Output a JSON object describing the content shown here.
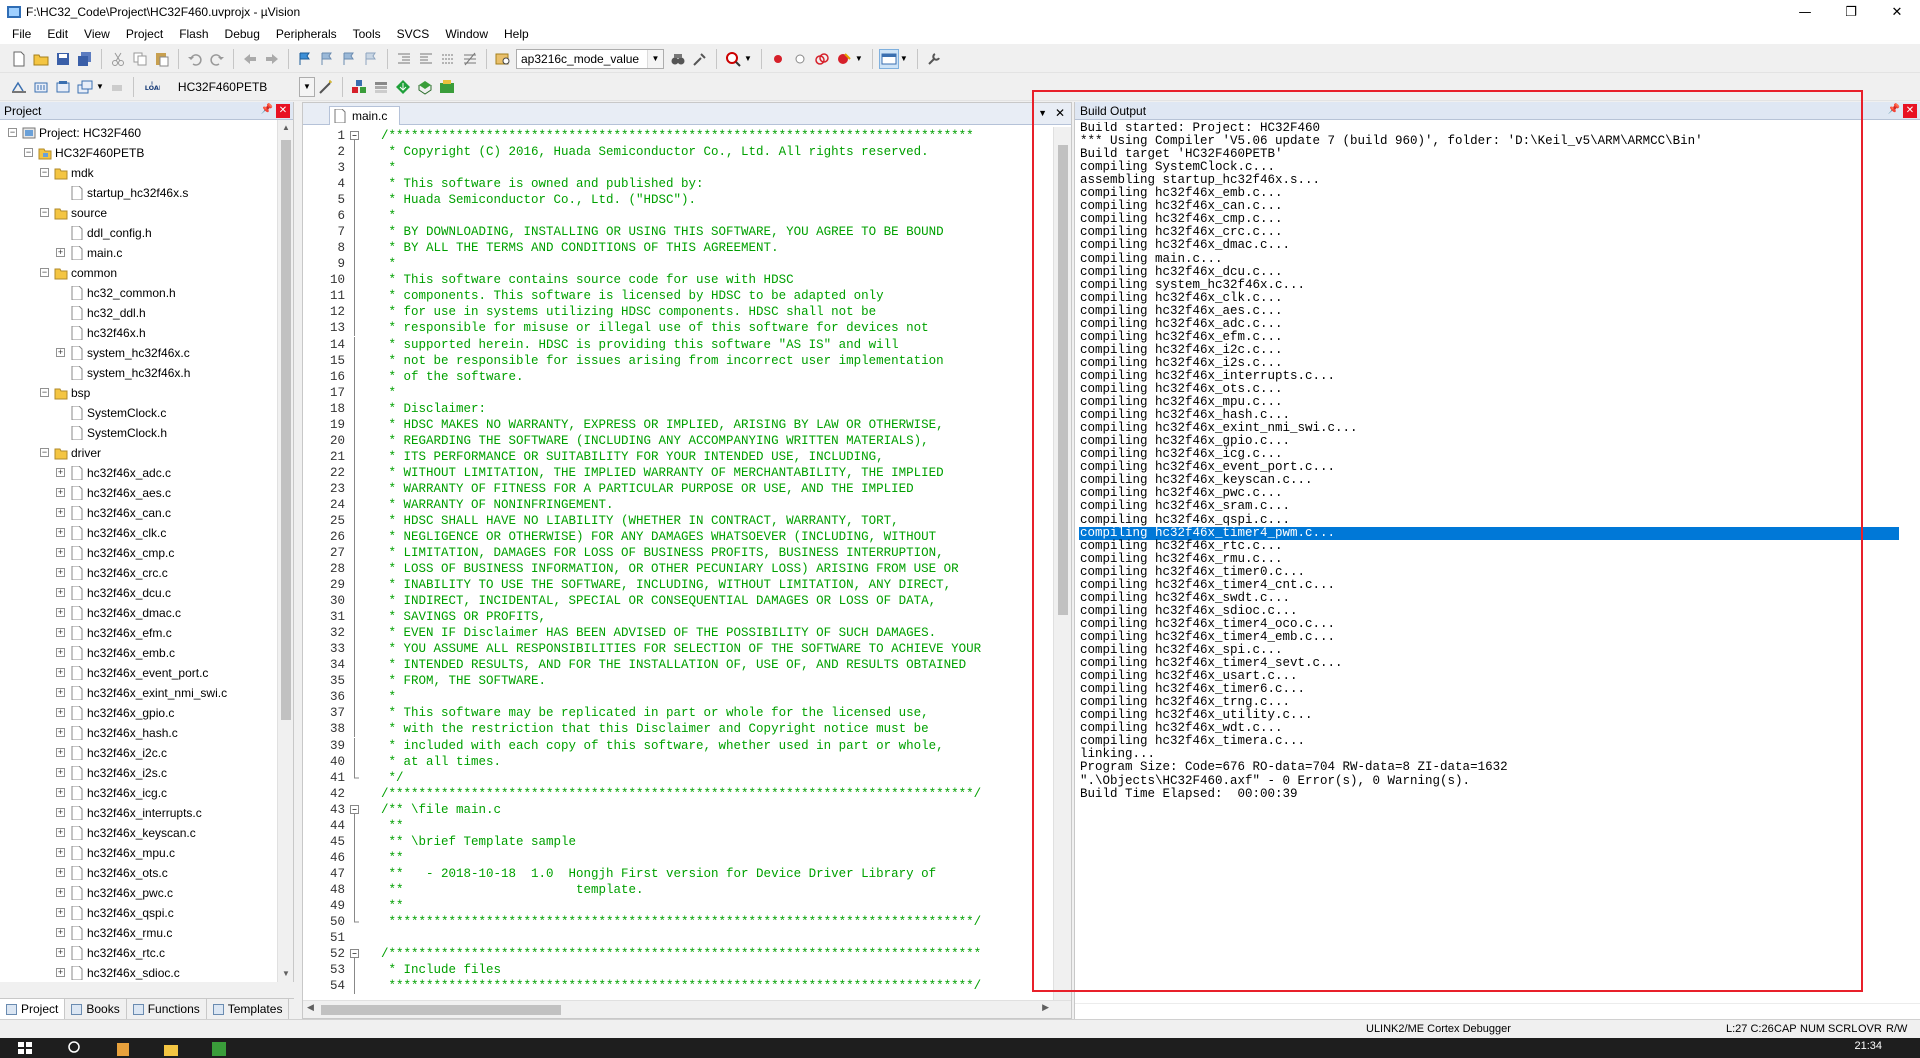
{
  "window": {
    "title": "F:\\HC32_Code\\Project\\HC32F460.uvprojx - µVision",
    "minimize": "—",
    "maximize": "❐",
    "close": "✕"
  },
  "menu": [
    "File",
    "Edit",
    "View",
    "Project",
    "Flash",
    "Debug",
    "Peripherals",
    "Tools",
    "SVCS",
    "Window",
    "Help"
  ],
  "toolbar1": {
    "function_combo": "ap3216c_mode_value"
  },
  "toolbar2": {
    "load_label": "LOAD",
    "target_combo": "HC32F460PETB"
  },
  "project_panel": {
    "title": "Project",
    "tree": [
      {
        "label": "Project: HC32F460",
        "level": 0,
        "type": "project",
        "expander": "−"
      },
      {
        "label": "HC32F460PETB",
        "level": 1,
        "type": "target",
        "expander": "−"
      },
      {
        "label": "mdk",
        "level": 2,
        "type": "folder",
        "expander": "−"
      },
      {
        "label": "startup_hc32f46x.s",
        "level": 3,
        "type": "file",
        "expander": ""
      },
      {
        "label": "source",
        "level": 2,
        "type": "folder",
        "expander": "−"
      },
      {
        "label": "ddl_config.h",
        "level": 3,
        "type": "file",
        "expander": ""
      },
      {
        "label": "main.c",
        "level": 3,
        "type": "file",
        "expander": "+"
      },
      {
        "label": "common",
        "level": 2,
        "type": "folder",
        "expander": "−"
      },
      {
        "label": "hc32_common.h",
        "level": 3,
        "type": "file",
        "expander": ""
      },
      {
        "label": "hc32_ddl.h",
        "level": 3,
        "type": "file",
        "expander": ""
      },
      {
        "label": "hc32f46x.h",
        "level": 3,
        "type": "file",
        "expander": ""
      },
      {
        "label": "system_hc32f46x.c",
        "level": 3,
        "type": "file",
        "expander": "+"
      },
      {
        "label": "system_hc32f46x.h",
        "level": 3,
        "type": "file",
        "expander": ""
      },
      {
        "label": "bsp",
        "level": 2,
        "type": "folder",
        "expander": "−"
      },
      {
        "label": "SystemClock.c",
        "level": 3,
        "type": "file",
        "expander": ""
      },
      {
        "label": "SystemClock.h",
        "level": 3,
        "type": "file",
        "expander": ""
      },
      {
        "label": "driver",
        "level": 2,
        "type": "folder",
        "expander": "−"
      },
      {
        "label": "hc32f46x_adc.c",
        "level": 3,
        "type": "file",
        "expander": "+"
      },
      {
        "label": "hc32f46x_aes.c",
        "level": 3,
        "type": "file",
        "expander": "+"
      },
      {
        "label": "hc32f46x_can.c",
        "level": 3,
        "type": "file",
        "expander": "+"
      },
      {
        "label": "hc32f46x_clk.c",
        "level": 3,
        "type": "file",
        "expander": "+"
      },
      {
        "label": "hc32f46x_cmp.c",
        "level": 3,
        "type": "file",
        "expander": "+"
      },
      {
        "label": "hc32f46x_crc.c",
        "level": 3,
        "type": "file",
        "expander": "+"
      },
      {
        "label": "hc32f46x_dcu.c",
        "level": 3,
        "type": "file",
        "expander": "+"
      },
      {
        "label": "hc32f46x_dmac.c",
        "level": 3,
        "type": "file",
        "expander": "+"
      },
      {
        "label": "hc32f46x_efm.c",
        "level": 3,
        "type": "file",
        "expander": "+"
      },
      {
        "label": "hc32f46x_emb.c",
        "level": 3,
        "type": "file",
        "expander": "+"
      },
      {
        "label": "hc32f46x_event_port.c",
        "level": 3,
        "type": "file",
        "expander": "+"
      },
      {
        "label": "hc32f46x_exint_nmi_swi.c",
        "level": 3,
        "type": "file",
        "expander": "+"
      },
      {
        "label": "hc32f46x_gpio.c",
        "level": 3,
        "type": "file",
        "expander": "+"
      },
      {
        "label": "hc32f46x_hash.c",
        "level": 3,
        "type": "file",
        "expander": "+"
      },
      {
        "label": "hc32f46x_i2c.c",
        "level": 3,
        "type": "file",
        "expander": "+"
      },
      {
        "label": "hc32f46x_i2s.c",
        "level": 3,
        "type": "file",
        "expander": "+"
      },
      {
        "label": "hc32f46x_icg.c",
        "level": 3,
        "type": "file",
        "expander": "+"
      },
      {
        "label": "hc32f46x_interrupts.c",
        "level": 3,
        "type": "file",
        "expander": "+"
      },
      {
        "label": "hc32f46x_keyscan.c",
        "level": 3,
        "type": "file",
        "expander": "+"
      },
      {
        "label": "hc32f46x_mpu.c",
        "level": 3,
        "type": "file",
        "expander": "+"
      },
      {
        "label": "hc32f46x_ots.c",
        "level": 3,
        "type": "file",
        "expander": "+"
      },
      {
        "label": "hc32f46x_pwc.c",
        "level": 3,
        "type": "file",
        "expander": "+"
      },
      {
        "label": "hc32f46x_qspi.c",
        "level": 3,
        "type": "file",
        "expander": "+"
      },
      {
        "label": "hc32f46x_rmu.c",
        "level": 3,
        "type": "file",
        "expander": "+"
      },
      {
        "label": "hc32f46x_rtc.c",
        "level": 3,
        "type": "file",
        "expander": "+"
      },
      {
        "label": "hc32f46x_sdioc.c",
        "level": 3,
        "type": "file",
        "expander": "+"
      }
    ],
    "tabs": [
      {
        "label": "Project",
        "active": true
      },
      {
        "label": "Books",
        "active": false
      },
      {
        "label": "Functions",
        "active": false
      },
      {
        "label": "Templates",
        "active": false
      }
    ]
  },
  "editor": {
    "tab": "main.c",
    "lines": [
      {
        "n": "1",
        "fold": "top",
        "text": "/******************************************************************************"
      },
      {
        "n": "2",
        "fold": "bar",
        "text": " * Copyright (C) 2016, Huada Semiconductor Co., Ltd. All rights reserved."
      },
      {
        "n": "3",
        "fold": "bar",
        "text": " *"
      },
      {
        "n": "4",
        "fold": "bar",
        "text": " * This software is owned and published by:"
      },
      {
        "n": "5",
        "fold": "bar",
        "text": " * Huada Semiconductor Co., Ltd. (\"HDSC\")."
      },
      {
        "n": "6",
        "fold": "bar",
        "text": " *"
      },
      {
        "n": "7",
        "fold": "bar",
        "text": " * BY DOWNLOADING, INSTALLING OR USING THIS SOFTWARE, YOU AGREE TO BE BOUND"
      },
      {
        "n": "8",
        "fold": "bar",
        "text": " * BY ALL THE TERMS AND CONDITIONS OF THIS AGREEMENT."
      },
      {
        "n": "9",
        "fold": "bar",
        "text": " *"
      },
      {
        "n": "10",
        "fold": "bar",
        "text": " * This software contains source code for use with HDSC"
      },
      {
        "n": "11",
        "fold": "bar",
        "text": " * components. This software is licensed by HDSC to be adapted only"
      },
      {
        "n": "12",
        "fold": "bar",
        "text": " * for use in systems utilizing HDSC components. HDSC shall not be"
      },
      {
        "n": "13",
        "fold": "bar",
        "text": " * responsible for misuse or illegal use of this software for devices not"
      },
      {
        "n": "14",
        "fold": "bar",
        "text": " * supported herein. HDSC is providing this software \"AS IS\" and will"
      },
      {
        "n": "15",
        "fold": "bar",
        "text": " * not be responsible for issues arising from incorrect user implementation"
      },
      {
        "n": "16",
        "fold": "bar",
        "text": " * of the software."
      },
      {
        "n": "17",
        "fold": "bar",
        "text": " *"
      },
      {
        "n": "18",
        "fold": "bar",
        "text": " * Disclaimer:"
      },
      {
        "n": "19",
        "fold": "bar",
        "text": " * HDSC MAKES NO WARRANTY, EXPRESS OR IMPLIED, ARISING BY LAW OR OTHERWISE,"
      },
      {
        "n": "20",
        "fold": "bar",
        "text": " * REGARDING THE SOFTWARE (INCLUDING ANY ACCOMPANYING WRITTEN MATERIALS),"
      },
      {
        "n": "21",
        "fold": "bar",
        "text": " * ITS PERFORMANCE OR SUITABILITY FOR YOUR INTENDED USE, INCLUDING,"
      },
      {
        "n": "22",
        "fold": "bar",
        "text": " * WITHOUT LIMITATION, THE IMPLIED WARRANTY OF MERCHANTABILITY, THE IMPLIED"
      },
      {
        "n": "23",
        "fold": "bar",
        "text": " * WARRANTY OF FITNESS FOR A PARTICULAR PURPOSE OR USE, AND THE IMPLIED"
      },
      {
        "n": "24",
        "fold": "bar",
        "text": " * WARRANTY OF NONINFRINGEMENT."
      },
      {
        "n": "25",
        "fold": "bar",
        "text": " * HDSC SHALL HAVE NO LIABILITY (WHETHER IN CONTRACT, WARRANTY, TORT,"
      },
      {
        "n": "26",
        "fold": "bar",
        "text": " * NEGLIGENCE OR OTHERWISE) FOR ANY DAMAGES WHATSOEVER (INCLUDING, WITHOUT"
      },
      {
        "n": "27",
        "fold": "bar",
        "text": " * LIMITATION, DAMAGES FOR LOSS OF BUSINESS PROFITS, BUSINESS INTERRUPTION,"
      },
      {
        "n": "28",
        "fold": "bar",
        "text": " * LOSS OF BUSINESS INFORMATION, OR OTHER PECUNIARY LOSS) ARISING FROM USE OR"
      },
      {
        "n": "29",
        "fold": "bar",
        "text": " * INABILITY TO USE THE SOFTWARE, INCLUDING, WITHOUT LIMITATION, ANY DIRECT,"
      },
      {
        "n": "30",
        "fold": "bar",
        "text": " * INDIRECT, INCIDENTAL, SPECIAL OR CONSEQUENTIAL DAMAGES OR LOSS OF DATA,"
      },
      {
        "n": "31",
        "fold": "bar",
        "text": " * SAVINGS OR PROFITS,"
      },
      {
        "n": "32",
        "fold": "bar",
        "text": " * EVEN IF Disclaimer HAS BEEN ADVISED OF THE POSSIBILITY OF SUCH DAMAGES."
      },
      {
        "n": "33",
        "fold": "bar",
        "text": " * YOU ASSUME ALL RESPONSIBILITIES FOR SELECTION OF THE SOFTWARE TO ACHIEVE YOUR"
      },
      {
        "n": "34",
        "fold": "bar",
        "text": " * INTENDED RESULTS, AND FOR THE INSTALLATION OF, USE OF, AND RESULTS OBTAINED"
      },
      {
        "n": "35",
        "fold": "bar",
        "text": " * FROM, THE SOFTWARE."
      },
      {
        "n": "36",
        "fold": "bar",
        "text": " *"
      },
      {
        "n": "37",
        "fold": "bar",
        "text": " * This software may be replicated in part or whole for the licensed use,"
      },
      {
        "n": "38",
        "fold": "bar",
        "text": " * with the restriction that this Disclaimer and Copyright notice must be"
      },
      {
        "n": "39",
        "fold": "bar",
        "text": " * included with each copy of this software, whether used in part or whole,"
      },
      {
        "n": "40",
        "fold": "bar",
        "text": " * at all times."
      },
      {
        "n": "41",
        "fold": "end",
        "text": " */"
      },
      {
        "n": "42",
        "fold": "",
        "text": "/******************************************************************************/"
      },
      {
        "n": "43",
        "fold": "top",
        "text": "/** \\file main.c"
      },
      {
        "n": "44",
        "fold": "bar",
        "text": " **"
      },
      {
        "n": "45",
        "fold": "bar",
        "text": " ** \\brief Template sample"
      },
      {
        "n": "46",
        "fold": "bar",
        "text": " **"
      },
      {
        "n": "47",
        "fold": "bar",
        "text": " **   - 2018-10-18  1.0  Hongjh First version for Device Driver Library of"
      },
      {
        "n": "48",
        "fold": "bar",
        "text": " **                       template."
      },
      {
        "n": "49",
        "fold": "bar",
        "text": " **"
      },
      {
        "n": "50",
        "fold": "end",
        "text": " ******************************************************************************/"
      },
      {
        "n": "51",
        "fold": "",
        "text": ""
      },
      {
        "n": "52",
        "fold": "top",
        "text": "/*******************************************************************************"
      },
      {
        "n": "53",
        "fold": "bar",
        "text": " * Include files"
      },
      {
        "n": "54",
        "fold": "bar",
        "text": " ******************************************************************************/"
      }
    ]
  },
  "build_output": {
    "title": "Build Output",
    "selected_index": 31,
    "lines": [
      "Build started: Project: HC32F460",
      "*** Using Compiler 'V5.06 update 7 (build 960)', folder: 'D:\\Keil_v5\\ARM\\ARMCC\\Bin'",
      "Build target 'HC32F460PETB'",
      "compiling SystemClock.c...",
      "assembling startup_hc32f46x.s...",
      "compiling hc32f46x_emb.c...",
      "compiling hc32f46x_can.c...",
      "compiling hc32f46x_cmp.c...",
      "compiling hc32f46x_crc.c...",
      "compiling hc32f46x_dmac.c...",
      "compiling main.c...",
      "compiling hc32f46x_dcu.c...",
      "compiling system_hc32f46x.c...",
      "compiling hc32f46x_clk.c...",
      "compiling hc32f46x_aes.c...",
      "compiling hc32f46x_adc.c...",
      "compiling hc32f46x_efm.c...",
      "compiling hc32f46x_i2c.c...",
      "compiling hc32f46x_i2s.c...",
      "compiling hc32f46x_interrupts.c...",
      "compiling hc32f46x_ots.c...",
      "compiling hc32f46x_mpu.c...",
      "compiling hc32f46x_hash.c...",
      "compiling hc32f46x_exint_nmi_swi.c...",
      "compiling hc32f46x_gpio.c...",
      "compiling hc32f46x_icg.c...",
      "compiling hc32f46x_event_port.c...",
      "compiling hc32f46x_keyscan.c...",
      "compiling hc32f46x_pwc.c...",
      "compiling hc32f46x_sram.c...",
      "compiling hc32f46x_qspi.c...",
      "compiling hc32f46x_timer4_pwm.c...",
      "compiling hc32f46x_rtc.c...",
      "compiling hc32f46x_rmu.c...",
      "compiling hc32f46x_timer0.c...",
      "compiling hc32f46x_timer4_cnt.c...",
      "compiling hc32f46x_swdt.c...",
      "compiling hc32f46x_sdioc.c...",
      "compiling hc32f46x_timer4_oco.c...",
      "compiling hc32f46x_timer4_emb.c...",
      "compiling hc32f46x_spi.c...",
      "compiling hc32f46x_timer4_sevt.c...",
      "compiling hc32f46x_usart.c...",
      "compiling hc32f46x_timer6.c...",
      "compiling hc32f46x_trng.c...",
      "compiling hc32f46x_utility.c...",
      "compiling hc32f46x_wdt.c...",
      "compiling hc32f46x_timera.c...",
      "linking...",
      "Program Size: Code=676 RO-data=704 RW-data=8 ZI-data=1632",
      "\".\\Objects\\HC32F460.axf\" - 0 Error(s), 0 Warning(s).",
      "Build Time Elapsed:  00:00:39"
    ]
  },
  "status": {
    "debugger": "ULINK2/ME Cortex Debugger",
    "position": "L:27 C:26",
    "caps": "CAP",
    "num": "NUM",
    "scrl": "SCRL",
    "ovr": "OVR",
    "rw": "R/W"
  },
  "taskbar": {
    "time": "21:34"
  },
  "colors": {
    "comment": "#00a000",
    "selection": "#0078d7",
    "highlight_box": "#e8202a"
  }
}
